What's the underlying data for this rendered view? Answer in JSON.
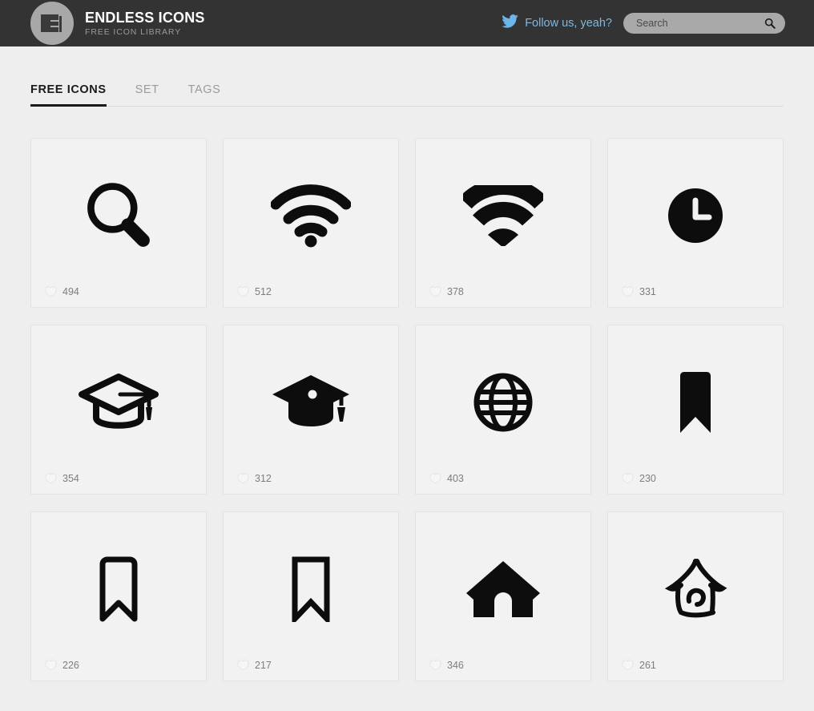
{
  "header": {
    "logo_icon": "grid-layout-logo-icon",
    "brand_title": "ENDLESS ICONS",
    "brand_subtitle": "FREE ICON LIBRARY",
    "twitter_icon": "twitter-bird-icon",
    "follow_label": "Follow us, yeah?",
    "search": {
      "placeholder": "Search",
      "value": "",
      "icon": "search-icon"
    },
    "colors": {
      "background": "#333333",
      "link": "#7fb8e0",
      "logo_circle": "#a8a8a8",
      "search_field": "#a9a9a9"
    }
  },
  "tabs": [
    {
      "label": "FREE ICONS",
      "active": true
    },
    {
      "label": "SET",
      "active": false
    },
    {
      "label": "TAGS",
      "active": false
    }
  ],
  "grid": {
    "download_badge_icon": "download-count-icon",
    "cards": [
      {
        "icon": "magnifier-search-icon",
        "count": "494"
      },
      {
        "icon": "wifi-signal-icon",
        "count": "512"
      },
      {
        "icon": "wifi-signal-bold-icon",
        "count": "378"
      },
      {
        "icon": "clock-filled-icon",
        "count": "331"
      },
      {
        "icon": "graduation-cap-outline-icon",
        "count": "354"
      },
      {
        "icon": "graduation-cap-filled-icon",
        "count": "312"
      },
      {
        "icon": "globe-icon",
        "count": "403"
      },
      {
        "icon": "bookmark-filled-icon",
        "count": "230"
      },
      {
        "icon": "bookmark-outline-rounded-icon",
        "count": "226"
      },
      {
        "icon": "bookmark-outline-square-icon",
        "count": "217"
      },
      {
        "icon": "house-filled-icon",
        "count": "346"
      },
      {
        "icon": "house-sketch-icon",
        "count": "261"
      }
    ]
  }
}
